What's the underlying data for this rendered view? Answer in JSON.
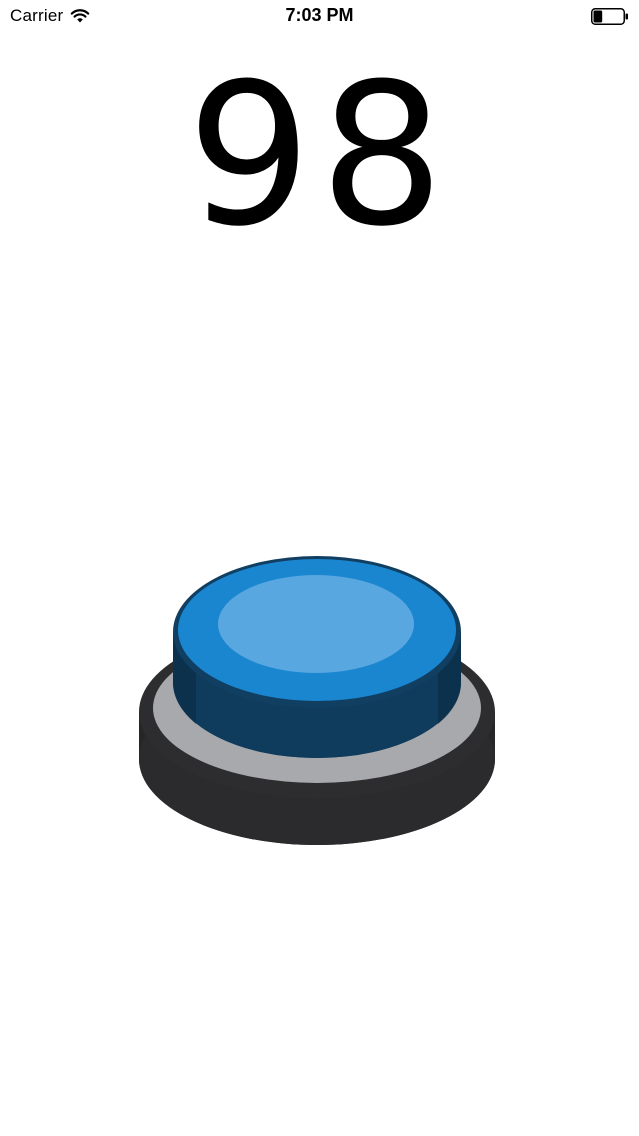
{
  "status_bar": {
    "carrier": "Carrier",
    "time": "7:03 PM",
    "wifi_icon": "wifi-icon",
    "battery_icon": "battery-icon",
    "battery_level": 0.3
  },
  "counter": {
    "value": "98"
  },
  "button": {
    "icon": "push-button",
    "colors": {
      "cap_top": "#59a7e0",
      "cap_rim": "#1a86cf",
      "cap_side": "#0d3a5a",
      "ring": "#a8a9ad",
      "base": "#2b2b2d"
    }
  }
}
